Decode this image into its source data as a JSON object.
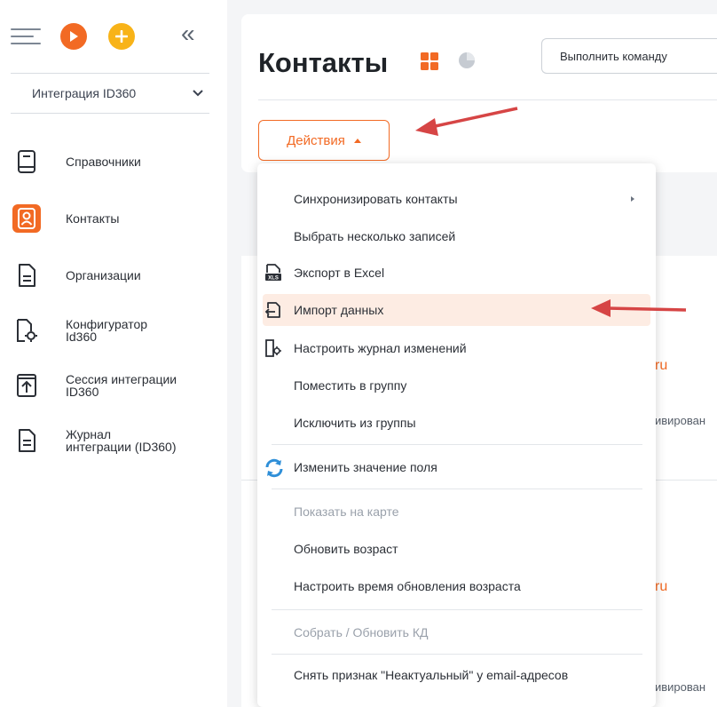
{
  "sidebar": {
    "integration_select": "Интеграция ID360",
    "items": [
      {
        "label": "Справочники"
      },
      {
        "label": "Контакты"
      },
      {
        "label": "Организации"
      },
      {
        "label": "Конфигуратор\nId360"
      },
      {
        "label": "Сессия интеграции\nID360"
      },
      {
        "label": "Журнал\nинтеграции (ID360)"
      }
    ]
  },
  "header": {
    "title": "Контакты",
    "command_placeholder": "Выполнить команду",
    "actions_label": "Действия"
  },
  "background": {
    "link1": "ru",
    "status1": "ивирован",
    "link2": "l.ru",
    "status2": "ивирован"
  },
  "menu": {
    "items": [
      {
        "label": "Синхронизировать контакты"
      },
      {
        "label": "Выбрать несколько записей"
      },
      {
        "label": "Экспорт в Excel"
      },
      {
        "label": "Импорт данных"
      },
      {
        "label": "Настроить журнал изменений"
      },
      {
        "label": "Поместить в группу"
      },
      {
        "label": "Исключить из группы"
      },
      {
        "label": "Изменить значение поля"
      },
      {
        "label": "Показать на карте"
      },
      {
        "label": "Обновить возраст"
      },
      {
        "label": "Настроить время обновления возраста"
      },
      {
        "label": "Собрать / Обновить КД"
      },
      {
        "label": "Снять признак \"Неактуальный\" у email-адресов"
      }
    ]
  },
  "icons": {
    "burger": "menu-icon",
    "play": "play-icon",
    "add": "plus-icon",
    "collapse": "collapse-icon",
    "chevron": "chevron-down-icon",
    "grid": "grid-view-icon",
    "chart": "pie-chart-icon",
    "export": "excel-export-icon",
    "import": "import-icon",
    "journal": "settings-journal-icon",
    "refresh": "refresh-icon"
  },
  "colors": {
    "accent": "#f26a24",
    "accent_yellow": "#f8b318",
    "highlight_bg": "#fdece3",
    "arrow_red": "#d64545"
  }
}
